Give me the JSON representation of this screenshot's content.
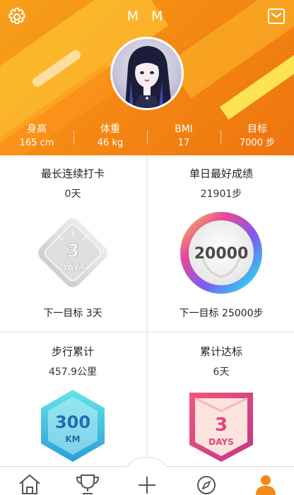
{
  "header": {
    "username": "M M",
    "stats": [
      {
        "label": "身高",
        "value": "165 cm"
      },
      {
        "label": "体重",
        "value": "46 kg"
      },
      {
        "label": "BMI",
        "value": "17"
      },
      {
        "label": "目标",
        "value": "7000 步"
      }
    ]
  },
  "cards": {
    "streak": {
      "title": "最长连续打卡",
      "value": "0天",
      "badge_top": "3",
      "badge_bottom": "DAYS",
      "next": "下一目标  3天"
    },
    "best_day": {
      "title": "单日最好成绩",
      "value": "21901步",
      "badge_number": "20000",
      "next": "下一目标  25000步"
    },
    "distance": {
      "title": "步行累计",
      "value": "457.9公里",
      "badge_top": "300",
      "badge_bottom": "KM"
    },
    "goal_days": {
      "title": "累计达标",
      "value": "6天",
      "badge_top": "3",
      "badge_bottom": "DAYS"
    }
  },
  "nav": {
    "items": [
      "home-icon",
      "trophy-icon",
      "plus-icon",
      "compass-icon",
      "profile-icon"
    ],
    "active": "profile-icon",
    "accent": "#f4891a"
  }
}
